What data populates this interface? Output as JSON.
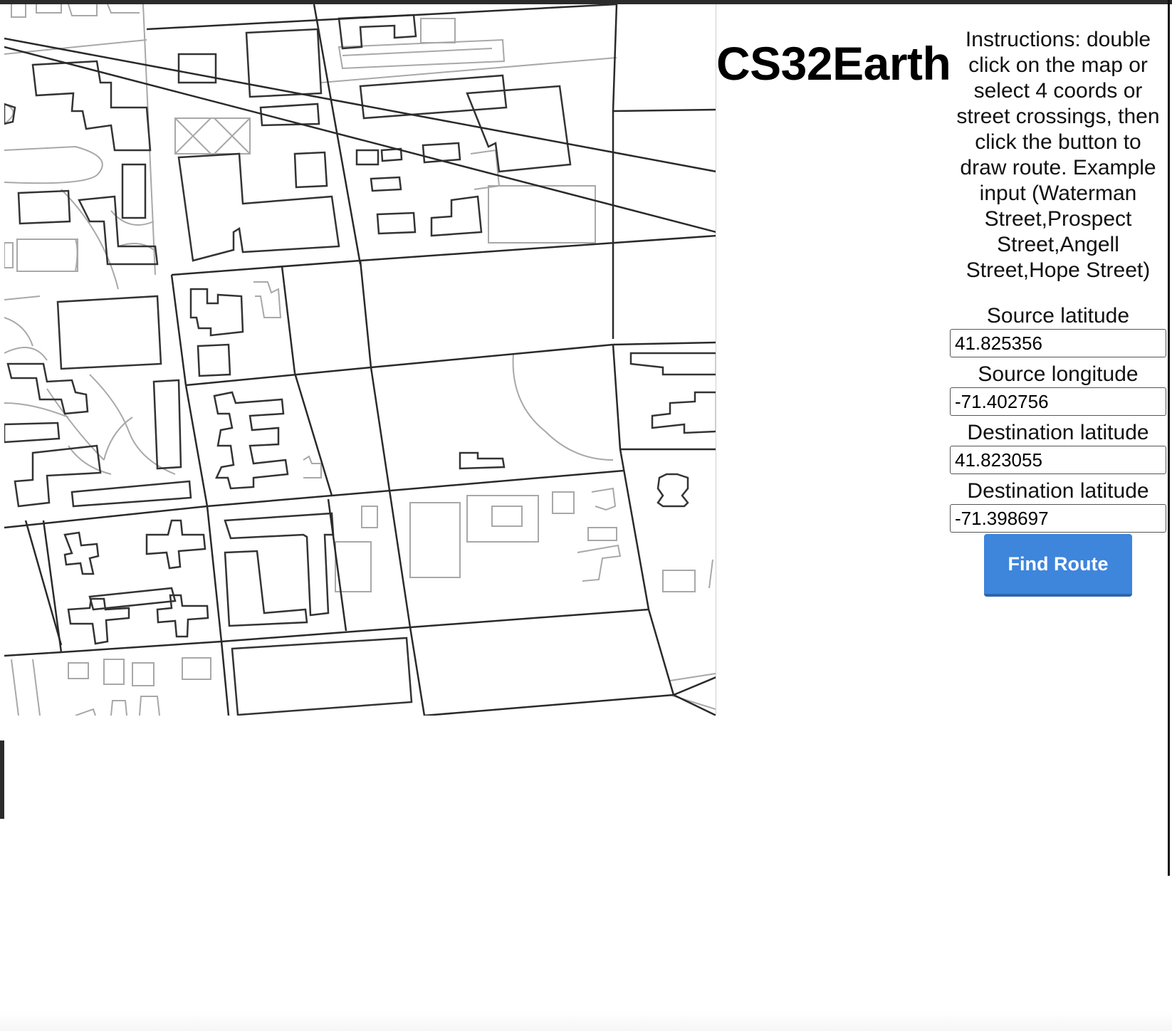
{
  "app": {
    "title": "CS32Earth"
  },
  "panel": {
    "instructions": "Instructions: double click on the map or select 4 coords or street crossings, then click the button to draw route. Example input (Waterman Street,Prospect Street,Angell Street,Hope Street)"
  },
  "form": {
    "source_lat_label": "Source latitude",
    "source_lat_value": "41.825356",
    "source_lon_label": "Source longitude",
    "source_lon_value": "-71.402756",
    "dest_lat_label": "Destination latitude",
    "dest_lat_value": "41.823055",
    "dest_lon_label": "Destination latitude",
    "dest_lon_value": "-71.398697"
  },
  "button": {
    "find_route_label": "Find Route"
  },
  "colors": {
    "button_bg": "#3e85dc",
    "button_text": "#ffffff",
    "map_dark_stroke": "#333333",
    "map_light_stroke": "#a8a8a8"
  },
  "icons": {
    "map": "street-map-tiles"
  }
}
